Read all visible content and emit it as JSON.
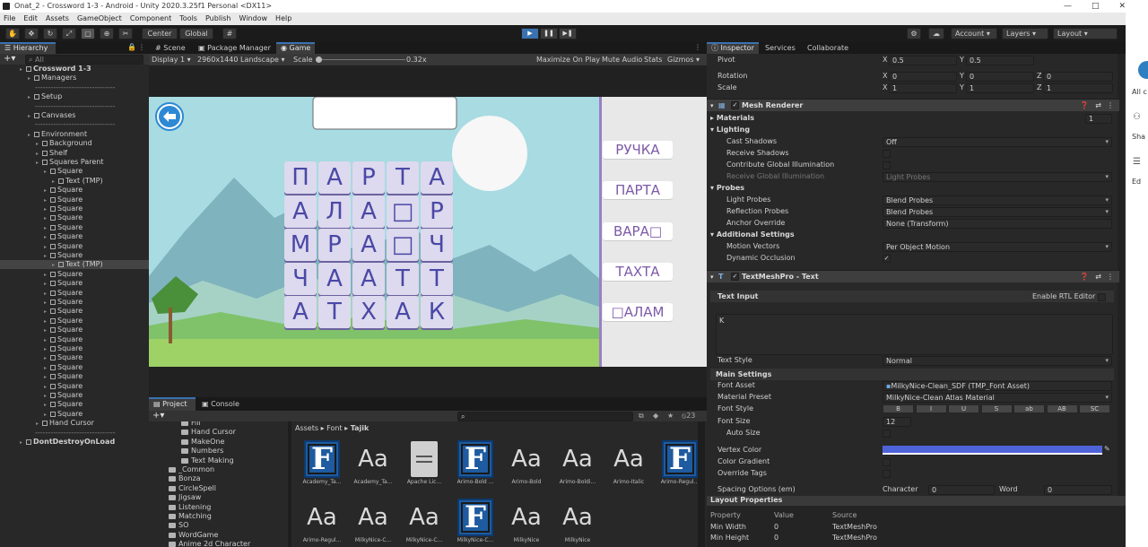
{
  "window": {
    "title": "Onat_2 - Crossword 1-3 - Android - Unity 2020.3.25f1 Personal <DX11>",
    "minimize": "—",
    "maximize": "□",
    "close": "✕"
  },
  "menu": [
    "File",
    "Edit",
    "Assets",
    "GameObject",
    "Component",
    "Tools",
    "Publish",
    "Window",
    "Help"
  ],
  "toolbar": {
    "pivot_center": "Center",
    "pivot_global": "Global",
    "account": "Account",
    "layers": "Layers",
    "layout": "Layout",
    "play": "▶",
    "pause": "❚❚",
    "step": "▶❚"
  },
  "hierarchy": {
    "tab": "Hierarchy",
    "search_placeholder": "All",
    "rows": [
      {
        "label": "Crossword 1-3",
        "indent": 0,
        "type": "scene"
      },
      {
        "label": "Managers",
        "indent": 1,
        "type": "obj"
      },
      {
        "label": "-------------------------------",
        "indent": 1,
        "type": "sep"
      },
      {
        "label": "Setup",
        "indent": 1,
        "type": "obj"
      },
      {
        "label": "-------------------------------",
        "indent": 1,
        "type": "sep"
      },
      {
        "label": "Canvases",
        "indent": 1,
        "type": "obj"
      },
      {
        "label": "-------------------------------",
        "indent": 1,
        "type": "sep"
      },
      {
        "label": "Environment",
        "indent": 1,
        "type": "obj"
      },
      {
        "label": "Background",
        "indent": 2,
        "type": "obj"
      },
      {
        "label": "Shelf",
        "indent": 2,
        "type": "obj"
      },
      {
        "label": "Squares Parent",
        "indent": 2,
        "type": "obj"
      },
      {
        "label": "Square",
        "indent": 3,
        "type": "obj"
      },
      {
        "label": "Text (TMP)",
        "indent": 4,
        "type": "obj"
      },
      {
        "label": "Square",
        "indent": 3,
        "type": "obj"
      },
      {
        "label": "Square",
        "indent": 3,
        "type": "obj"
      },
      {
        "label": "Square",
        "indent": 3,
        "type": "obj"
      },
      {
        "label": "Square",
        "indent": 3,
        "type": "obj"
      },
      {
        "label": "Square",
        "indent": 3,
        "type": "obj"
      },
      {
        "label": "Square",
        "indent": 3,
        "type": "obj"
      },
      {
        "label": "Square",
        "indent": 3,
        "type": "obj"
      },
      {
        "label": "Square",
        "indent": 3,
        "type": "obj"
      },
      {
        "label": "Text (TMP)",
        "indent": 4,
        "type": "obj"
      },
      {
        "label": "Square",
        "indent": 3,
        "type": "obj"
      },
      {
        "label": "Square",
        "indent": 3,
        "type": "obj"
      },
      {
        "label": "Square",
        "indent": 3,
        "type": "obj"
      },
      {
        "label": "Square",
        "indent": 3,
        "type": "obj"
      },
      {
        "label": "Square",
        "indent": 3,
        "type": "obj"
      },
      {
        "label": "Square",
        "indent": 3,
        "type": "obj"
      },
      {
        "label": "Square",
        "indent": 3,
        "type": "obj"
      },
      {
        "label": "Square",
        "indent": 3,
        "type": "obj"
      },
      {
        "label": "Square",
        "indent": 3,
        "type": "obj"
      },
      {
        "label": "Square",
        "indent": 3,
        "type": "obj"
      },
      {
        "label": "Square",
        "indent": 3,
        "type": "obj"
      },
      {
        "label": "Square",
        "indent": 3,
        "type": "obj"
      },
      {
        "label": "Square",
        "indent": 3,
        "type": "obj"
      },
      {
        "label": "Square",
        "indent": 3,
        "type": "obj"
      },
      {
        "label": "Square",
        "indent": 3,
        "type": "obj"
      },
      {
        "label": "Square",
        "indent": 3,
        "type": "obj"
      },
      {
        "label": "Hand Cursor",
        "indent": 2,
        "type": "obj"
      },
      {
        "label": "-------------------------------",
        "indent": 1,
        "type": "sep"
      },
      {
        "label": "DontDestroyOnLoad",
        "indent": 0,
        "type": "scene"
      }
    ]
  },
  "scene_tabs": [
    "Scene",
    "Package Manager",
    "Game"
  ],
  "gamebar": {
    "display": "Display 1",
    "resolution": "2960x1440 Landscape",
    "scale_label": "Scale",
    "scale_value": "0.32x",
    "maximize": "Maximize On Play",
    "mute": "Mute Audio",
    "stats": "Stats",
    "gizmos": "Gizmos"
  },
  "game": {
    "grid": [
      [
        "П",
        "А",
        "Р",
        "Т",
        "А"
      ],
      [
        "А",
        "Л",
        "А",
        "□",
        "Р"
      ],
      [
        "М",
        "Р",
        "А",
        "□",
        "Ч"
      ],
      [
        "Ч",
        "А",
        "А",
        "Т",
        "Т"
      ],
      [
        "А",
        "Т",
        "Х",
        "А",
        "К"
      ]
    ],
    "words": [
      "РУЧКА",
      "ПАРТА",
      "ВАРА□",
      "ТАХТА",
      "□АЛАМ"
    ],
    "colors": {
      "cell": "#ddd9ee",
      "letter": "#4a48a6",
      "word": "#7d5aa8",
      "sky": "#a8dbe2"
    }
  },
  "project": {
    "tabs": [
      "Project",
      "Console"
    ],
    "count": "23",
    "folders": [
      "Fill",
      "Hand Cursor",
      "MakeOne",
      "Numbers",
      "Text Making",
      "_Common",
      "Bonza",
      "CircleSpell",
      "Jigsaw",
      "Listening",
      "Matching",
      "SO",
      "WordGame",
      "Anime 2d Character"
    ],
    "breadcrumb": [
      "Assets",
      "Font",
      "Tajik"
    ],
    "assets_row1": [
      {
        "icon": "F",
        "label": "Academy_Ta..."
      },
      {
        "icon": "Aa",
        "label": "Academy_Ta..."
      },
      {
        "icon": "doc",
        "label": "Apache Lic..."
      },
      {
        "icon": "F",
        "label": "Arimo-Bold ..."
      },
      {
        "icon": "Aa",
        "label": "Arimo-Bold"
      },
      {
        "icon": "Aa",
        "label": "Arimo-Boldi..."
      },
      {
        "icon": "Aa",
        "label": "Arimo-Italic"
      },
      {
        "icon": "F",
        "label": "Arimo-Regul..."
      }
    ],
    "assets_row2": [
      {
        "icon": "Aa",
        "label": "Arimo-Regul..."
      },
      {
        "icon": "Aa",
        "label": "MilkyNice-C..."
      },
      {
        "icon": "Aa",
        "label": "MilkyNice-C..."
      },
      {
        "icon": "F",
        "label": "MilkyNice-C..."
      },
      {
        "icon": "Aa",
        "label": "MilkyNice"
      },
      {
        "icon": "Aa",
        "label": "MilkyNice"
      }
    ]
  },
  "inspector": {
    "tabs": [
      "Inspector",
      "Services",
      "Collaborate"
    ],
    "transform": {
      "pivot": "Pivot",
      "pivot_x": "0.5",
      "pivot_y": "0.5",
      "rotation": "Rotation",
      "rot_x": "0",
      "rot_y": "0",
      "rot_z": "0",
      "scale": "Scale",
      "scale_x": "1",
      "scale_y": "1",
      "scale_z": "1"
    },
    "mesh_renderer": {
      "title": "Mesh Renderer",
      "materials": "Materials",
      "materials_count": "1",
      "lighting": "Lighting",
      "cast_shadows": "Cast Shadows",
      "cast_shadows_value": "Off",
      "receive_shadows": "Receive Shadows",
      "contribute_gi": "Contribute Global Illumination",
      "receive_gi": "Receive Global Illumination",
      "receive_gi_value": "Light Probes",
      "probes": "Probes",
      "light_probes": "Light Probes",
      "light_probes_value": "Blend Probes",
      "reflection_probes": "Reflection Probes",
      "reflection_probes_value": "Blend Probes",
      "anchor_override": "Anchor Override",
      "anchor_override_value": "None (Transform)",
      "additional": "Additional Settings",
      "motion_vectors": "Motion Vectors",
      "motion_vectors_value": "Per Object Motion",
      "dynamic_occlusion": "Dynamic Occlusion"
    },
    "tmp": {
      "title": "TextMeshPro - Text",
      "text_input": "Text Input",
      "enable_rtl": "Enable RTL Editor",
      "text": "K",
      "text_style": "Text Style",
      "text_style_value": "Normal",
      "main_settings": "Main Settings",
      "font_asset": "Font Asset",
      "font_asset_value": "MilkyNice-Clean_SDF (TMP_Font Asset)",
      "material_preset": "Material Preset",
      "material_preset_value": "MilkyNice-Clean Atlas Material",
      "font_style": "Font Style",
      "style_buttons": [
        "B",
        "I",
        "U",
        "S",
        "ab",
        "AB",
        "SC"
      ],
      "font_size": "Font Size",
      "font_size_value": "12",
      "auto_size": "Auto Size",
      "vertex_color": "Vertex Color",
      "vertex_color_hex": "#4f63d8",
      "color_gradient": "Color Gradient",
      "override_tags": "Override Tags",
      "spacing": "Spacing Options (em)",
      "character": "Character",
      "character_value": "0",
      "word": "Word",
      "word_value": "0"
    },
    "layout": {
      "title": "Layout Properties",
      "headers": [
        "Property",
        "Value",
        "Source"
      ],
      "rows": [
        [
          "Min Width",
          "0",
          "TextMeshPro"
        ],
        [
          "Min Height",
          "0",
          "TextMeshPro"
        ]
      ]
    }
  },
  "sidepanel": {
    "items": [
      "All c",
      "Sha",
      "Ed"
    ]
  }
}
